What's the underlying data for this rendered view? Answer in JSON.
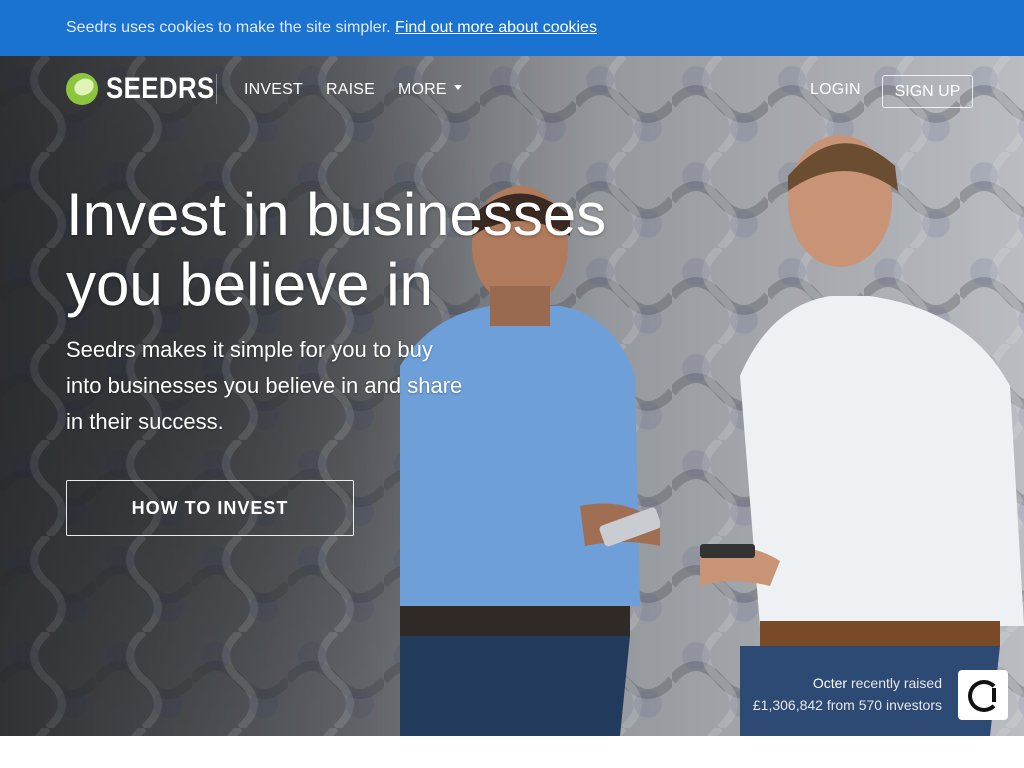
{
  "cookie_bar": {
    "text": "Seedrs uses cookies to make the site simpler.",
    "link": "Find out more about cookies"
  },
  "nav": {
    "logo_text": "SEEDRS",
    "items": [
      {
        "label": "INVEST"
      },
      {
        "label": "RAISE"
      },
      {
        "label": "MORE"
      }
    ],
    "login": "LOGIN",
    "signup": "SIGN UP"
  },
  "hero": {
    "headline_line1": "Invest in businesses",
    "headline_line2": "you believe in",
    "subtitle": "Seedrs makes it simple for you to buy into businesses you believe in and share in their success.",
    "cta": "HOW TO INVEST"
  },
  "raised": {
    "company": "Octer",
    "suffix": "recently raised",
    "amount_line": "£1,306,842 from 570 investors"
  },
  "colors": {
    "cookie_bar": "#1a73d1",
    "logo_green": "#8cc63f"
  }
}
